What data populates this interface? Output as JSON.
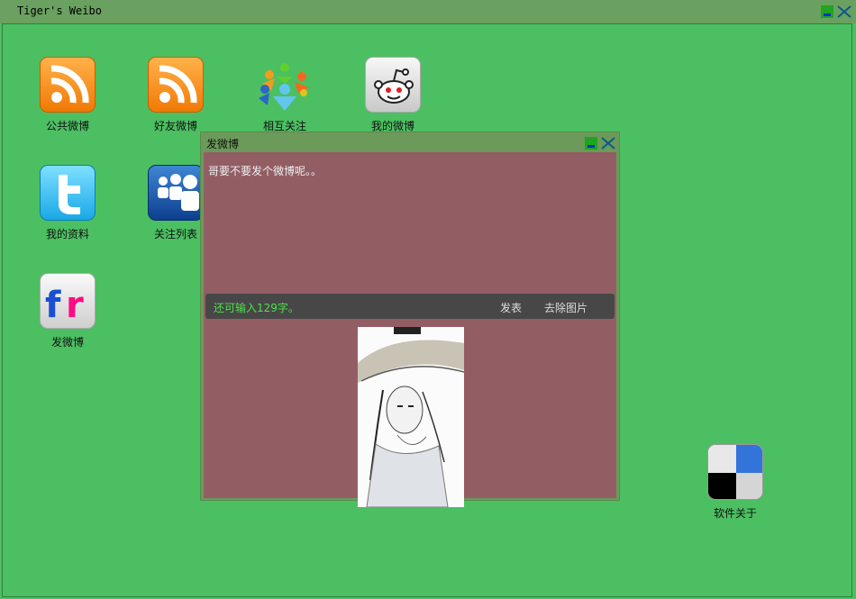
{
  "window": {
    "title": "Tiger's Weibo"
  },
  "desktop_icons": [
    {
      "label": "公共微博",
      "icon": "rss-icon"
    },
    {
      "label": "好友微博",
      "icon": "rss-icon"
    },
    {
      "label": "相互关注",
      "icon": "people-circle-icon"
    },
    {
      "label": "我的微博",
      "icon": "reddit-alien-icon"
    },
    {
      "label": "我的资料",
      "icon": "twitter-icon"
    },
    {
      "label": "关注列表",
      "icon": "myspace-icon"
    },
    {
      "label": "发微博",
      "icon": "flickr-icon"
    },
    {
      "label": "软件关于",
      "icon": "delicious-icon"
    }
  ],
  "dialog": {
    "title": "发微博",
    "compose_text": "哥要不要发个微博呢。。",
    "char_counter": "还可输入129字。",
    "post_label": "发表",
    "remove_image_label": "去除图片",
    "attached_image": "sketch-girl-with-hat-image"
  },
  "colors": {
    "desktop_bg": "#4cbf62",
    "titlebar_bg": "#6aa060",
    "dialog_body_bg": "#925e64",
    "bar_bg": "#474747",
    "counter_text": "#4de04d"
  }
}
